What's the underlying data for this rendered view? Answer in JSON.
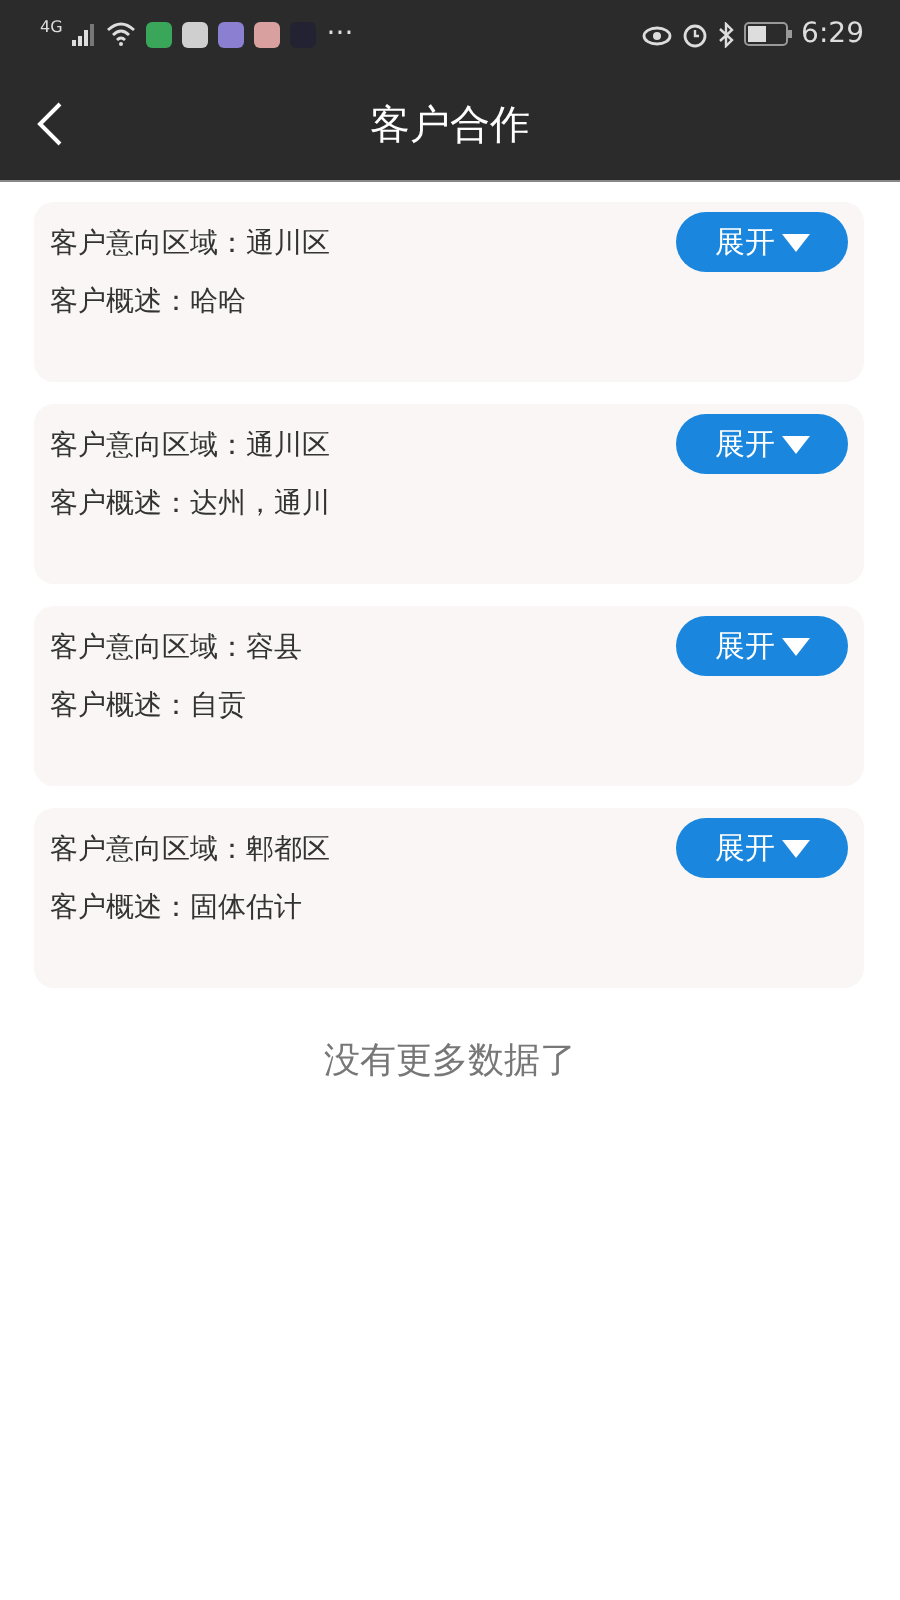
{
  "status_bar": {
    "network": "4G",
    "more": "···",
    "time": "6:29",
    "notifications": [
      {
        "color": "#3aa65a"
      },
      {
        "color": "#cfcfcf"
      },
      {
        "color": "#8a7fd0"
      },
      {
        "color": "#d9a0a0"
      },
      {
        "color": "#222233"
      }
    ]
  },
  "header": {
    "title": "客户合作"
  },
  "cards": [
    {
      "region": "客户意向区域：通川区",
      "summary": "客户概述：哈哈",
      "button": "展开"
    },
    {
      "region": "客户意向区域：通川区",
      "summary": "客户概述：达州，通川",
      "button": "展开"
    },
    {
      "region": "客户意向区域：容县",
      "summary": "客户概述：自贡",
      "button": "展开"
    },
    {
      "region": "客户意向区域：郫都区",
      "summary": "客户概述：固体估计",
      "button": "展开"
    }
  ],
  "footer": "没有更多数据了"
}
